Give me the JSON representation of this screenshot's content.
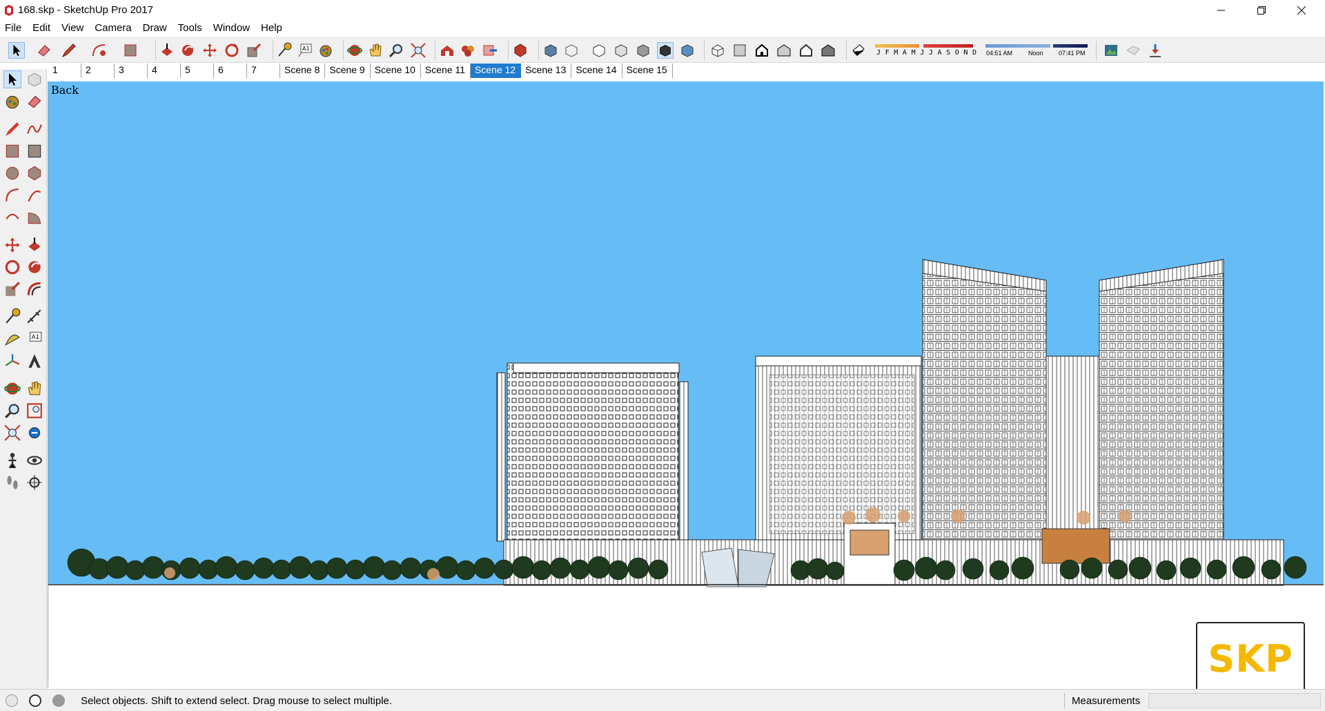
{
  "window": {
    "title": "168.skp - SketchUp Pro 2017",
    "controls": [
      "minimize-icon",
      "restore-icon",
      "close-icon"
    ]
  },
  "menu": [
    "File",
    "Edit",
    "View",
    "Camera",
    "Draw",
    "Tools",
    "Window",
    "Help"
  ],
  "toolbar": {
    "shadow_months": "J F M A M J J A S O N D",
    "time_start": "04:51 AM",
    "time_mid": "Noon",
    "time_end": "07:41 PM"
  },
  "scenes": {
    "tabs": [
      "1",
      "2",
      "3",
      "4",
      "5",
      "6",
      "7",
      "Scene 8",
      "Scene 9",
      "Scene 10",
      "Scene 11",
      "Scene 12",
      "Scene 13",
      "Scene 14",
      "Scene 15"
    ],
    "active": "Scene 12"
  },
  "viewport": {
    "view_label": "Back",
    "sky_color": "#66bdf6"
  },
  "logo": {
    "text": "SKP",
    "color": "#f5b800"
  },
  "status": {
    "message": "Select objects. Shift to extend select. Drag mouse to select multiple.",
    "measurements_label": "Measurements",
    "measurements_value": ""
  }
}
